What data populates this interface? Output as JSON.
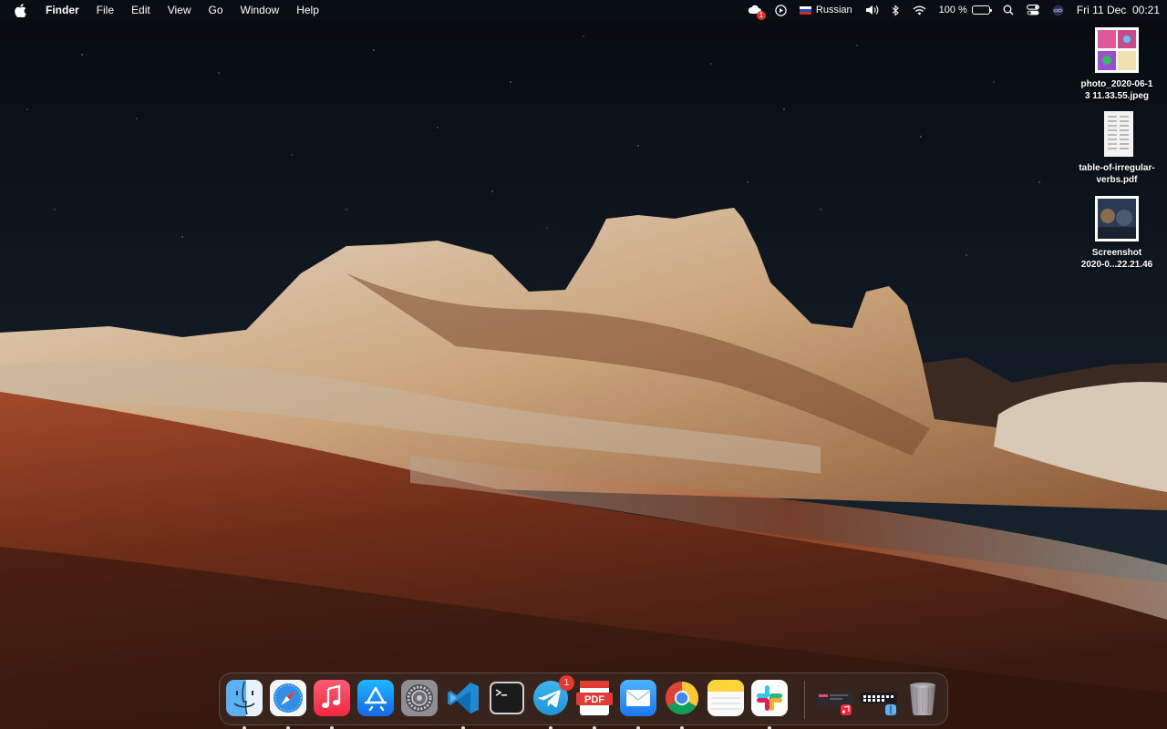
{
  "menubar": {
    "app_name": "Finder",
    "menus": [
      "File",
      "Edit",
      "View",
      "Go",
      "Window",
      "Help"
    ],
    "status": {
      "notification_badge": "1",
      "input_language": "Russian",
      "battery_percent": "100 %",
      "clock": "Fri 11 Dec  00:21"
    }
  },
  "desktop": {
    "files": [
      {
        "name": "photo_2020-06-1\n3 11.33.55.jpeg"
      },
      {
        "name": "table-of-irregular-\nverbs.pdf"
      },
      {
        "name": "Screenshot\n2020-0...22.21.46"
      }
    ]
  },
  "dock": {
    "apps": [
      {
        "name": "Finder",
        "icon": "finder-icon",
        "running": true
      },
      {
        "name": "Safari",
        "icon": "safari-icon",
        "running": true
      },
      {
        "name": "Music",
        "icon": "music-icon",
        "running": true
      },
      {
        "name": "App Store",
        "icon": "app-store-icon",
        "running": false
      },
      {
        "name": "System Preferences",
        "icon": "gear-icon",
        "running": false
      },
      {
        "name": "Visual Studio Code",
        "icon": "vscode-icon",
        "running": true
      },
      {
        "name": "Terminal",
        "icon": "terminal-icon",
        "running": false
      },
      {
        "name": "Telegram",
        "icon": "telegram-icon",
        "running": true,
        "badge": "1"
      },
      {
        "name": "PDF Expert",
        "icon": "pdf-icon",
        "running": true
      },
      {
        "name": "Mail",
        "icon": "mail-icon",
        "running": true
      },
      {
        "name": "Google Chrome",
        "icon": "chrome-icon",
        "running": true
      },
      {
        "name": "Notes",
        "icon": "notes-icon",
        "running": false
      },
      {
        "name": "Slack",
        "icon": "slack-icon",
        "running": true
      }
    ],
    "recent": [
      {
        "name": "Music window",
        "icon": "music-window-thumbnail"
      },
      {
        "name": "Finder window",
        "icon": "finder-window-thumbnail"
      },
      {
        "name": "Trash",
        "icon": "trash-icon"
      }
    ],
    "pdf_label": "PDF"
  },
  "colors": {
    "sky": "#0b1118",
    "sand": "#8a3a1e",
    "rock": "#d9c7ae",
    "badge": "#e8382f"
  }
}
